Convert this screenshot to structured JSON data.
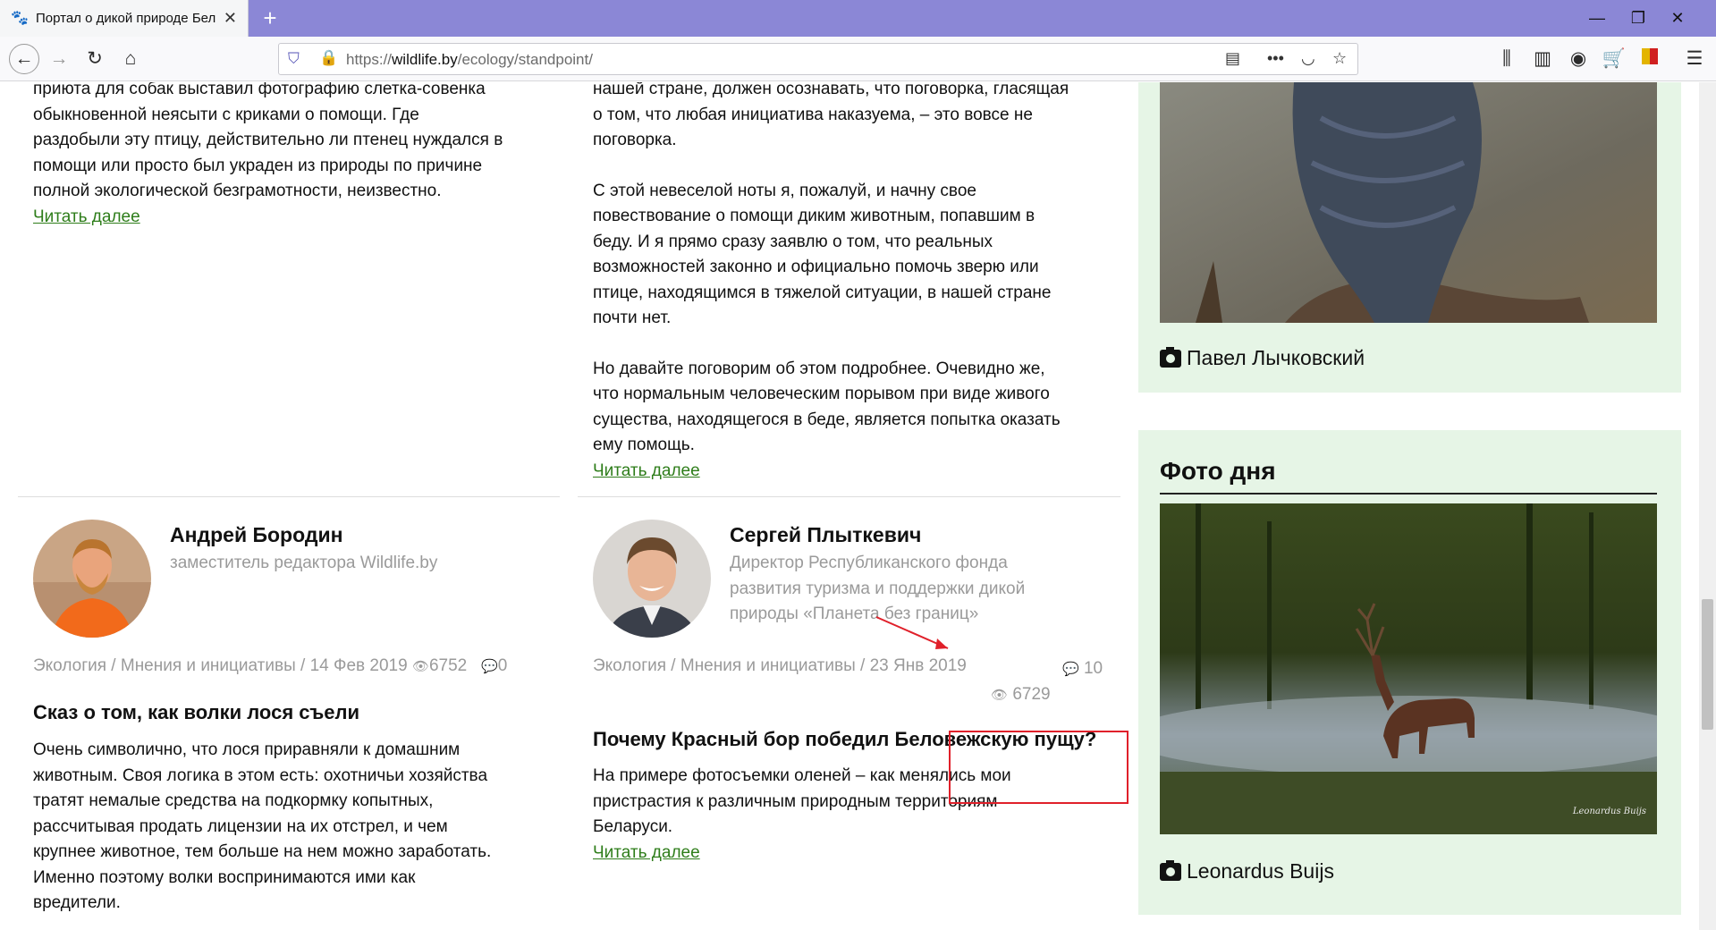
{
  "browser": {
    "tab_title": "Портал о дикой природе Бел",
    "new_tab": "+",
    "url_scheme": "https://",
    "url_host": "wildlife.by",
    "url_path": "/ecology/standpoint/",
    "controls": {
      "minimize": "—",
      "restore": "❐",
      "close": "✕"
    }
  },
  "article_left_top": {
    "lines": [
      "приюта для собак выставил фотографию слетка-совенка",
      "обыкновенной неясыти с криками о помощи. Где",
      "раздобыли эту птицу, действительно ли птенец нуждался в",
      "помощи или просто был украден из природы по причине",
      "полной экологической безграмотности, неизвестно."
    ],
    "read_more": "Читать далее"
  },
  "article_right_top": {
    "para1": [
      "нашей стране, должен осознавать, что поговорка, гласящая",
      "о том, что любая инициатива наказуема, – это вовсе не",
      "поговорка."
    ],
    "para2": [
      "С этой невеселой ноты я, пожалуй, и начну свое",
      "повествование о помощи диким животным, попавшим в",
      "беду. И я прямо сразу заявлю о том, что реальных",
      "возможностей законно и официально помочь зверю или",
      "птице, находящимся в тяжелой ситуации, в нашей стране",
      "почти нет."
    ],
    "para3": [
      "Но давайте поговорим об этом подробнее. Очевидно же,",
      "что нормальным человеческим порывом при виде живого",
      "существа, находящегося в беде, является попытка оказать",
      "ему помощь."
    ],
    "read_more": "Читать далее"
  },
  "card_left": {
    "author": "Андрей Бородин",
    "role": "заместитель редактора Wildlife.by",
    "meta": "Экология / Мнения и инициативы / 14 Фев 2019",
    "views": "6752",
    "comments": "0",
    "title": "Сказ о том, как волки лося съели",
    "text": [
      "Очень символично, что лося приравняли к домашним",
      "животным. Своя логика в этом есть: охотничьи хозяйства",
      "тратят немалые средства на подкормку копытных,",
      "рассчитывая продать лицензии на их отстрел, и чем",
      "крупнее животное, тем больше на нем можно заработать.",
      "Именно поэтому волки воспринимаются ими как",
      "вредители."
    ]
  },
  "card_right": {
    "author": "Сергей Плыткевич",
    "role": [
      "Директор Республиканского фонда",
      "развития туризма и поддержки дикой",
      "природы «Планета без границ»"
    ],
    "meta": "Экология / Мнения и инициативы / 23 Янв 2019",
    "comments": "10",
    "views": "6729",
    "title": "Почему Красный бор победил Беловежскую пущу?",
    "text": [
      "На примере фотосъемки оленей – как менялись мои",
      "пристрастия к различным природным территориям",
      "Беларуси."
    ],
    "read_more": "Читать далее"
  },
  "sidebar": {
    "photo1_caption": "Павел Лычковский",
    "section_title": "Фото дня",
    "photo2_caption": "Leonardus Buijs",
    "photo2_signature": "Leonardus Buijs"
  },
  "colors": {
    "link": "#2e7d1a",
    "sidebar_bg": "#e6f5e6",
    "tabbar": "#8b87d6",
    "annotation": "#e0202a"
  }
}
